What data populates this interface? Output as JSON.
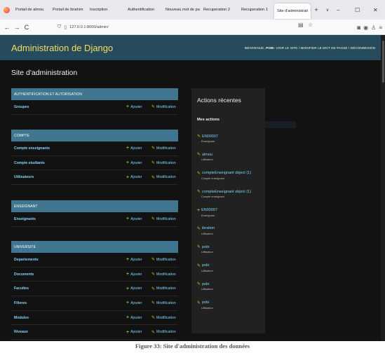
{
  "browser": {
    "tabs": [
      {
        "label": "Portail de almou"
      },
      {
        "label": "Portail de ibrahim"
      },
      {
        "label": "Inscription"
      },
      {
        "label": "Authentification"
      },
      {
        "label": "Nouveau mot de pa"
      },
      {
        "label": "Recuperation 2"
      },
      {
        "label": "Recuperation 1"
      },
      {
        "label": "Site d'administrati"
      }
    ],
    "active_tab_close": "×",
    "new_tab": "+",
    "tab_list": "∨",
    "window": {
      "minimize": "−",
      "maximize": "☐",
      "close": "✕"
    },
    "nav": {
      "back": "←",
      "forward": "→",
      "reload": "C"
    },
    "url": "127.0.0.1:8000/admin/",
    "icons": [
      "reader-icon",
      "bookmark-star-icon",
      "pocket-icon",
      "account-icon",
      "extensions-icon",
      "menu-icon"
    ]
  },
  "header": {
    "brand": "Administration de Django",
    "welcome": "BIENVENUE,",
    "user": "POBI",
    "links": [
      "VOIR LE SITE",
      "MODIFIER LE MOT DE PASSE",
      "DÉCONNEXION"
    ],
    "sep": " / "
  },
  "page_title": "Site d'administration",
  "add_label": "Ajouter",
  "change_label": "Modification",
  "modules": [
    {
      "caption": "AUTHENTIFICATION ET AUTORISATION",
      "rows": [
        "Groupes"
      ]
    },
    {
      "caption": "COMPTE",
      "rows": [
        "Compte enseignants",
        "Compte etudiants",
        "Utilisateurs"
      ]
    },
    {
      "caption": "ENSEIGNANT",
      "rows": [
        "Enseignants"
      ]
    },
    {
      "caption": "UNIVERSITE",
      "rows": [
        "Departements",
        "Documents",
        "Facultes",
        "Filieres",
        "Modules",
        "Niveaux"
      ]
    }
  ],
  "recent": {
    "title": "Actions récentes",
    "subtitle": "Mes actions",
    "items": [
      {
        "icon": "change",
        "label": "EN00007",
        "type": "Enseignant"
      },
      {
        "icon": "change",
        "label": "almou",
        "type": "Utilisateur"
      },
      {
        "icon": "change",
        "label": "compteEnseignant object (1)",
        "type": "Compte enseignant"
      },
      {
        "icon": "change",
        "label": "compteEnseignant object (1)",
        "type": "Compte enseignant"
      },
      {
        "icon": "add",
        "label": "EN00007",
        "type": "Enseignant"
      },
      {
        "icon": "change",
        "label": "ibrahim",
        "type": "Utilisateur"
      },
      {
        "icon": "change",
        "label": "pobi",
        "type": "Utilisateur"
      },
      {
        "icon": "change",
        "label": "pobi",
        "type": "Utilisateur"
      },
      {
        "icon": "change",
        "label": "pobi",
        "type": "Utilisateur"
      },
      {
        "icon": "change",
        "label": "pobi",
        "type": "Utilisateur"
      }
    ]
  },
  "caption": "Figure 33: Site d'administration des données",
  "colors": {
    "header_bg": "#264b5d",
    "brand": "#f5dd5d",
    "module_caption": "#417690",
    "link": "#81d4fa",
    "add_icon": "#70bf2b",
    "change_icon": "#efb80b"
  }
}
